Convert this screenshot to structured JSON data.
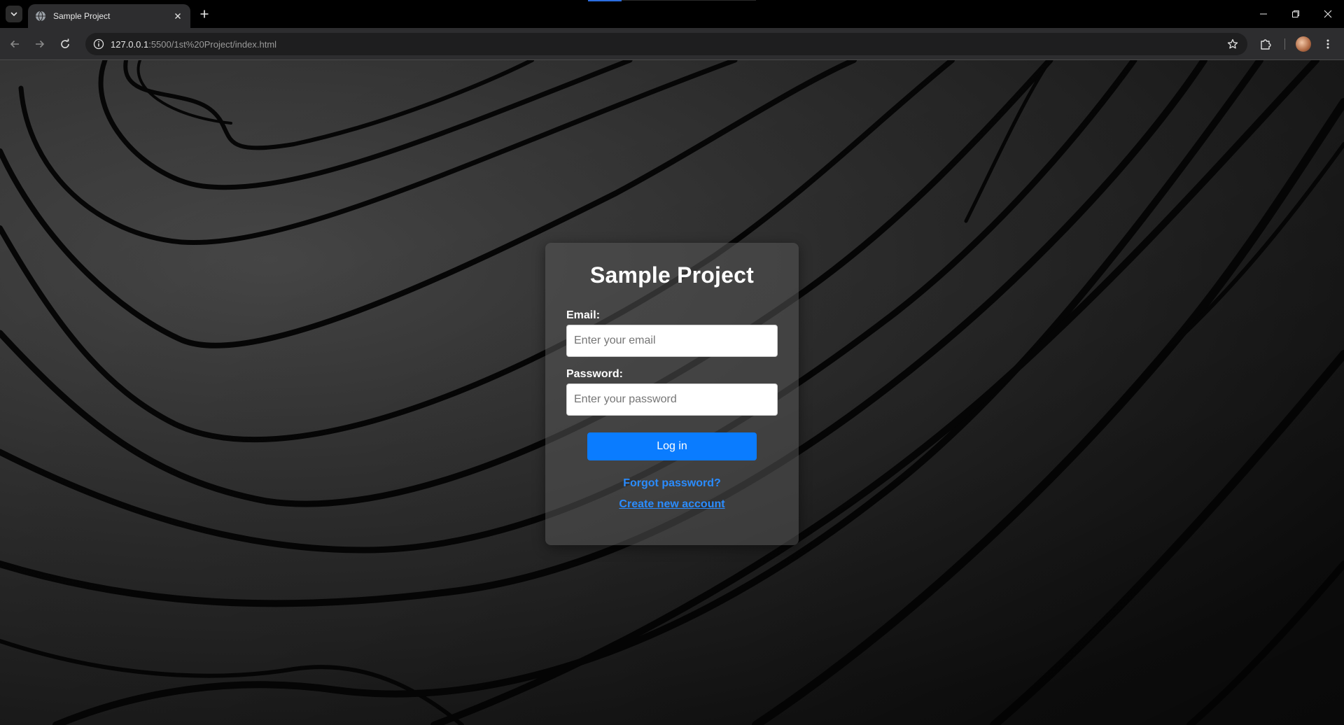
{
  "browser": {
    "tab_title": "Sample Project",
    "url_host": "127.0.0.1",
    "url_rest": ":5500/1st%20Project/index.html"
  },
  "page": {
    "title": "Sample Project",
    "email_label": "Email:",
    "email_placeholder": "Enter your email",
    "password_label": "Password:",
    "password_placeholder": "Enter your password",
    "login_label": "Log in",
    "forgot_label": "Forgot password?",
    "create_label": "Create new account"
  },
  "colors": {
    "accent": "#0a7cff",
    "link": "#2a8cff",
    "card": "rgba(85,85,85,0.55)"
  },
  "icons": [
    "tab-search-icon",
    "globe-icon",
    "close-icon",
    "plus-icon",
    "minimize-icon",
    "restore-icon",
    "back-icon",
    "forward-icon",
    "reload-icon",
    "info-icon",
    "star-icon",
    "extensions-icon",
    "profile-avatar",
    "menu-icon"
  ]
}
